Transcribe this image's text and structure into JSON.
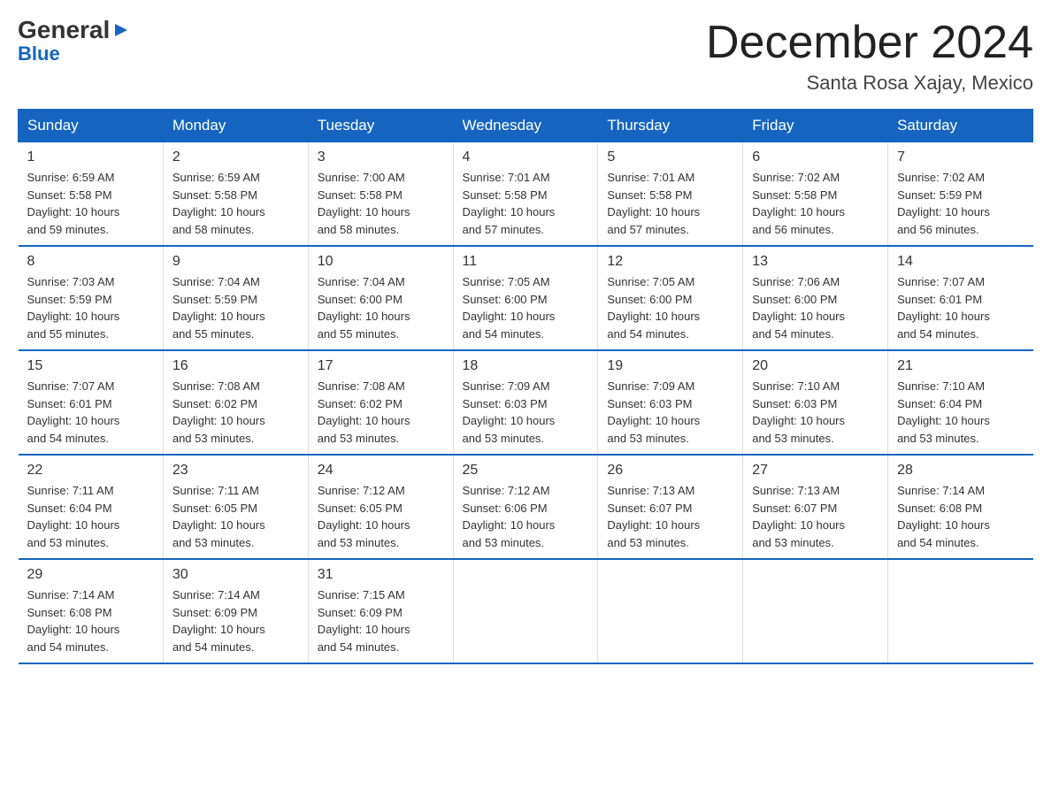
{
  "header": {
    "logo": {
      "general": "General",
      "blue": "Blue"
    },
    "month_title": "December 2024",
    "location": "Santa Rosa Xajay, Mexico"
  },
  "days_of_week": [
    "Sunday",
    "Monday",
    "Tuesday",
    "Wednesday",
    "Thursday",
    "Friday",
    "Saturday"
  ],
  "weeks": [
    [
      {
        "day": "1",
        "sunrise": "6:59 AM",
        "sunset": "5:58 PM",
        "daylight": "10 hours and 59 minutes."
      },
      {
        "day": "2",
        "sunrise": "6:59 AM",
        "sunset": "5:58 PM",
        "daylight": "10 hours and 58 minutes."
      },
      {
        "day": "3",
        "sunrise": "7:00 AM",
        "sunset": "5:58 PM",
        "daylight": "10 hours and 58 minutes."
      },
      {
        "day": "4",
        "sunrise": "7:01 AM",
        "sunset": "5:58 PM",
        "daylight": "10 hours and 57 minutes."
      },
      {
        "day": "5",
        "sunrise": "7:01 AM",
        "sunset": "5:58 PM",
        "daylight": "10 hours and 57 minutes."
      },
      {
        "day": "6",
        "sunrise": "7:02 AM",
        "sunset": "5:58 PM",
        "daylight": "10 hours and 56 minutes."
      },
      {
        "day": "7",
        "sunrise": "7:02 AM",
        "sunset": "5:59 PM",
        "daylight": "10 hours and 56 minutes."
      }
    ],
    [
      {
        "day": "8",
        "sunrise": "7:03 AM",
        "sunset": "5:59 PM",
        "daylight": "10 hours and 55 minutes."
      },
      {
        "day": "9",
        "sunrise": "7:04 AM",
        "sunset": "5:59 PM",
        "daylight": "10 hours and 55 minutes."
      },
      {
        "day": "10",
        "sunrise": "7:04 AM",
        "sunset": "6:00 PM",
        "daylight": "10 hours and 55 minutes."
      },
      {
        "day": "11",
        "sunrise": "7:05 AM",
        "sunset": "6:00 PM",
        "daylight": "10 hours and 54 minutes."
      },
      {
        "day": "12",
        "sunrise": "7:05 AM",
        "sunset": "6:00 PM",
        "daylight": "10 hours and 54 minutes."
      },
      {
        "day": "13",
        "sunrise": "7:06 AM",
        "sunset": "6:00 PM",
        "daylight": "10 hours and 54 minutes."
      },
      {
        "day": "14",
        "sunrise": "7:07 AM",
        "sunset": "6:01 PM",
        "daylight": "10 hours and 54 minutes."
      }
    ],
    [
      {
        "day": "15",
        "sunrise": "7:07 AM",
        "sunset": "6:01 PM",
        "daylight": "10 hours and 54 minutes."
      },
      {
        "day": "16",
        "sunrise": "7:08 AM",
        "sunset": "6:02 PM",
        "daylight": "10 hours and 53 minutes."
      },
      {
        "day": "17",
        "sunrise": "7:08 AM",
        "sunset": "6:02 PM",
        "daylight": "10 hours and 53 minutes."
      },
      {
        "day": "18",
        "sunrise": "7:09 AM",
        "sunset": "6:03 PM",
        "daylight": "10 hours and 53 minutes."
      },
      {
        "day": "19",
        "sunrise": "7:09 AM",
        "sunset": "6:03 PM",
        "daylight": "10 hours and 53 minutes."
      },
      {
        "day": "20",
        "sunrise": "7:10 AM",
        "sunset": "6:03 PM",
        "daylight": "10 hours and 53 minutes."
      },
      {
        "day": "21",
        "sunrise": "7:10 AM",
        "sunset": "6:04 PM",
        "daylight": "10 hours and 53 minutes."
      }
    ],
    [
      {
        "day": "22",
        "sunrise": "7:11 AM",
        "sunset": "6:04 PM",
        "daylight": "10 hours and 53 minutes."
      },
      {
        "day": "23",
        "sunrise": "7:11 AM",
        "sunset": "6:05 PM",
        "daylight": "10 hours and 53 minutes."
      },
      {
        "day": "24",
        "sunrise": "7:12 AM",
        "sunset": "6:05 PM",
        "daylight": "10 hours and 53 minutes."
      },
      {
        "day": "25",
        "sunrise": "7:12 AM",
        "sunset": "6:06 PM",
        "daylight": "10 hours and 53 minutes."
      },
      {
        "day": "26",
        "sunrise": "7:13 AM",
        "sunset": "6:07 PM",
        "daylight": "10 hours and 53 minutes."
      },
      {
        "day": "27",
        "sunrise": "7:13 AM",
        "sunset": "6:07 PM",
        "daylight": "10 hours and 53 minutes."
      },
      {
        "day": "28",
        "sunrise": "7:14 AM",
        "sunset": "6:08 PM",
        "daylight": "10 hours and 54 minutes."
      }
    ],
    [
      {
        "day": "29",
        "sunrise": "7:14 AM",
        "sunset": "6:08 PM",
        "daylight": "10 hours and 54 minutes."
      },
      {
        "day": "30",
        "sunrise": "7:14 AM",
        "sunset": "6:09 PM",
        "daylight": "10 hours and 54 minutes."
      },
      {
        "day": "31",
        "sunrise": "7:15 AM",
        "sunset": "6:09 PM",
        "daylight": "10 hours and 54 minutes."
      },
      {
        "day": "",
        "sunrise": "",
        "sunset": "",
        "daylight": ""
      },
      {
        "day": "",
        "sunrise": "",
        "sunset": "",
        "daylight": ""
      },
      {
        "day": "",
        "sunrise": "",
        "sunset": "",
        "daylight": ""
      },
      {
        "day": "",
        "sunrise": "",
        "sunset": "",
        "daylight": ""
      }
    ]
  ],
  "labels": {
    "sunrise": "Sunrise:",
    "sunset": "Sunset:",
    "daylight": "Daylight:"
  }
}
